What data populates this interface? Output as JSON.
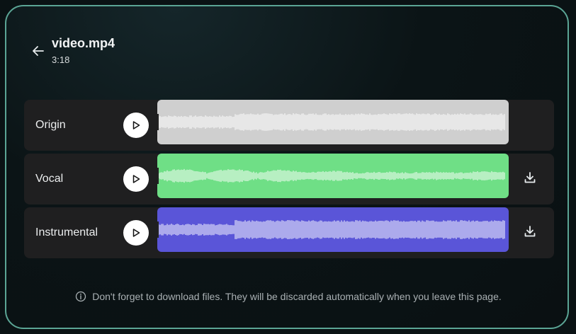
{
  "header": {
    "title": "video.mp4",
    "duration": "3:18"
  },
  "tracks": [
    {
      "label": "Origin",
      "wave_color": "#cfcfcf",
      "has_download": false
    },
    {
      "label": "Vocal",
      "wave_color": "#6fdf86",
      "has_download": true
    },
    {
      "label": "Instrumental",
      "wave_color": "#5a55d8",
      "has_download": true
    }
  ],
  "notice": {
    "text": "Don't forget to download files. They will be discarded automatically when you leave this page."
  },
  "colors": {
    "panel_border": "#5ba595",
    "track_bg": "#1f1f20",
    "wave_bars": "#ffffff"
  }
}
